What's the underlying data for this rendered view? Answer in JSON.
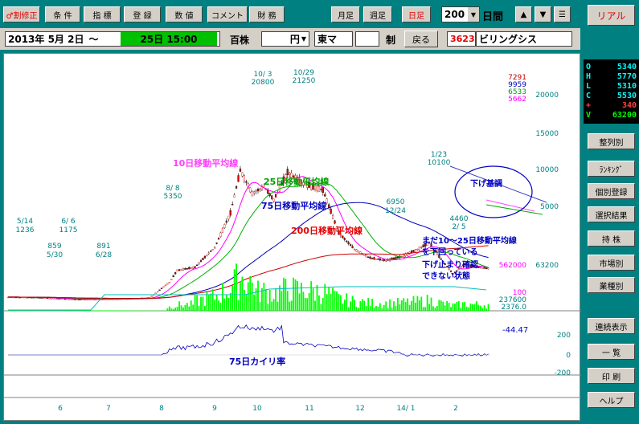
{
  "toolbar": {
    "buttons": [
      "♂割修正",
      "条 件",
      "指 標",
      "登 録",
      "数 値",
      "コメント",
      "財 務"
    ],
    "period_buttons": [
      "月足",
      "週足",
      "日足"
    ],
    "days_value": "200",
    "days_unit": "日間",
    "arrows": [
      "▲",
      "▼",
      "☰"
    ]
  },
  "realtime_button": "リアル",
  "infobar": {
    "date_from": "2013年 5月 2日",
    "tilde": "〜",
    "date_to": "25日 15:00",
    "unit": "百株",
    "currency": "円",
    "market": "東マ",
    "system": "制",
    "back": "戻る",
    "code": "3623",
    "name": "ビリングシス"
  },
  "ohlc": [
    {
      "k": "O",
      "v": "5340",
      "c": "#00ffff"
    },
    {
      "k": "H",
      "v": "5770",
      "c": "#00ffff"
    },
    {
      "k": "L",
      "v": "5310",
      "c": "#00ffff"
    },
    {
      "k": "C",
      "v": "5530",
      "c": "#00ffff"
    },
    {
      "k": "+",
      "v": "340",
      "c": "#ff4040"
    },
    {
      "k": "V",
      "v": "63200",
      "c": "#00ff00"
    }
  ],
  "right_buttons": [
    "整列別",
    "ﾗﾝｷﾝｸﾞ",
    "個別登録",
    "選択結果",
    "持 株",
    "市場別",
    "業種別",
    "連続表示",
    "一 覧",
    "印 刷",
    "ヘルプ"
  ],
  "chart_data": {
    "type": "candlestick",
    "price_axis": [
      "20000",
      "15000",
      "10000",
      "5000"
    ],
    "ma_values": [
      {
        "v": "7291",
        "c": "#c00000"
      },
      {
        "v": "9959",
        "c": "#0000c0"
      },
      {
        "v": "6533",
        "c": "#00a000"
      },
      {
        "v": "5662",
        "c": "#ff00ff"
      }
    ],
    "volume_labels": [
      {
        "v": "562000",
        "c": "#ff00ff"
      },
      {
        "v": "63200",
        "c": "#008080"
      },
      {
        "v": "100",
        "c": "#ff00ff"
      },
      {
        "v": "237600",
        "c": "#008080"
      },
      {
        "v": "2376.0",
        "c": "#008080"
      }
    ],
    "kairi_axis": [
      "200",
      "0",
      "-200"
    ],
    "kairi_value": "-44.47",
    "months": [
      "6",
      "7",
      "8",
      "9",
      "10",
      "11",
      "12",
      "14/ 1",
      "2"
    ],
    "annotations": {
      "ma10": "10日移動平均線",
      "ma25": "25日移動平均線",
      "ma75": "75日移動平均線",
      "ma200": "200日移動平均線",
      "note1": "まだ10〜25日移動平均線",
      "note2": "を下回っている",
      "note3": "下げ止まり確認",
      "note4": "できない状態",
      "downtrend": "下げ基調",
      "kairi": "75日カイリ率"
    },
    "points": [
      {
        "d": "5/14",
        "v": "1236"
      },
      {
        "d": "6/ 6",
        "v": "1175"
      },
      {
        "d": "859",
        "v": "5/30"
      },
      {
        "d": "891",
        "v": "6/28"
      },
      {
        "d": "8/ 8",
        "v": "5350"
      },
      {
        "d": "10/ 3",
        "v": "20800"
      },
      {
        "d": "10/29",
        "v": "21250"
      },
      {
        "d": "6950",
        "v": "12/24"
      },
      {
        "d": "1/23",
        "v": "10100"
      },
      {
        "d": "4460",
        "v": "2/ 5"
      }
    ]
  }
}
